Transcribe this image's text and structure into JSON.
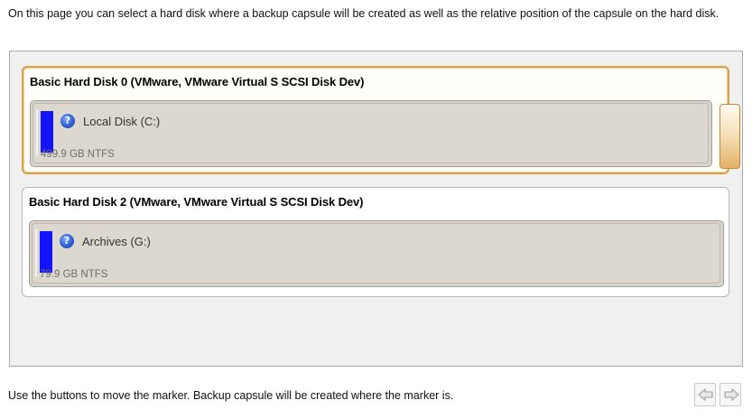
{
  "intro_text": "On this page you can select a hard disk where a backup capsule will be created as well as the relative position of the capsule on the hard disk.",
  "disks": [
    {
      "title": "Basic Hard Disk 0 (VMware, VMware Virtual S SCSI Disk Dev)",
      "selected": true,
      "partition": {
        "label": "Local Disk (C:)",
        "size": "499.9 GB NTFS",
        "icon": "help-icon"
      }
    },
    {
      "title": "Basic Hard Disk 2 (VMware, VMware Virtual S SCSI Disk Dev)",
      "selected": false,
      "partition": {
        "label": "Archives (G:)",
        "size": "79.9 GB NTFS",
        "icon": "help-icon"
      }
    }
  ],
  "footer_text": "Use the buttons to move the marker. Backup capsule will be created where the marker is.",
  "nav": {
    "left_icon": "arrow-left-icon",
    "right_icon": "arrow-right-icon"
  },
  "colors": {
    "volume_bar": "#1414ff",
    "selected_border": "#d9a24a",
    "marker": "#e4b066"
  }
}
